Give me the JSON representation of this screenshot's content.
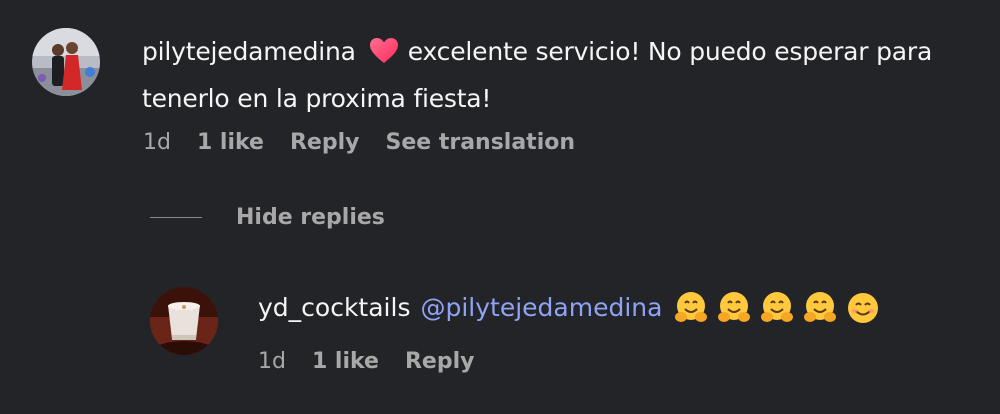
{
  "comment": {
    "username": "pilytejedamedina",
    "text": "excelente servicio! No puedo esperar para tenerlo en la proxima fiesta!",
    "time": "1d",
    "likes": "1 like",
    "reply_label": "Reply",
    "translation_label": "See translation",
    "heart_icon": "heart-icon"
  },
  "replies_toggle": {
    "label": "Hide replies"
  },
  "reply": {
    "username": "yd_cocktails",
    "mention": "@pilytejedamedina",
    "emojis": [
      "hugging-face-emoji",
      "hugging-face-emoji",
      "hugging-face-emoji",
      "hugging-face-emoji",
      "smiling-face-emoji"
    ],
    "time": "1d",
    "likes": "1 like",
    "reply_label": "Reply"
  },
  "colors": {
    "background": "#232428",
    "text": "#f5f5f5",
    "secondary": "#a8a8a8",
    "mention": "#8fa3f5",
    "heart": "#ff3b6b"
  }
}
